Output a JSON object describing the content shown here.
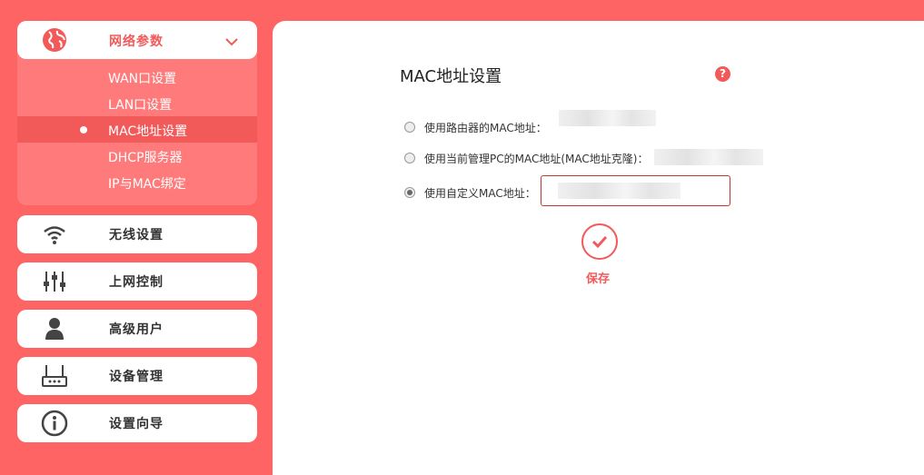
{
  "sidebar": {
    "network": {
      "label": "网络参数",
      "icon": "globe-icon",
      "subitems": [
        "WAN口设置",
        "LAN口设置",
        "MAC地址设置",
        "DHCP服务器",
        "IP与MAC绑定"
      ],
      "active_index": 2
    },
    "items": [
      {
        "label": "无线设置",
        "icon": "wifi-icon"
      },
      {
        "label": "上网控制",
        "icon": "sliders-icon"
      },
      {
        "label": "高级用户",
        "icon": "user-icon"
      },
      {
        "label": "设备管理",
        "icon": "router-icon"
      },
      {
        "label": "设置向导",
        "icon": "info-icon"
      }
    ]
  },
  "main": {
    "title": "MAC地址设置",
    "help": "?",
    "options": [
      {
        "label": "使用路由器的MAC地址：",
        "checked": false
      },
      {
        "label": "使用当前管理PC的MAC地址(MAC地址克隆)：",
        "checked": false
      },
      {
        "label": "使用自定义MAC地址：",
        "checked": true
      }
    ],
    "save_label": "保存"
  },
  "colors": {
    "accent": "#ff6464",
    "accent_dark": "#f25a5a",
    "submenu_bg": "#ff7a7a"
  }
}
